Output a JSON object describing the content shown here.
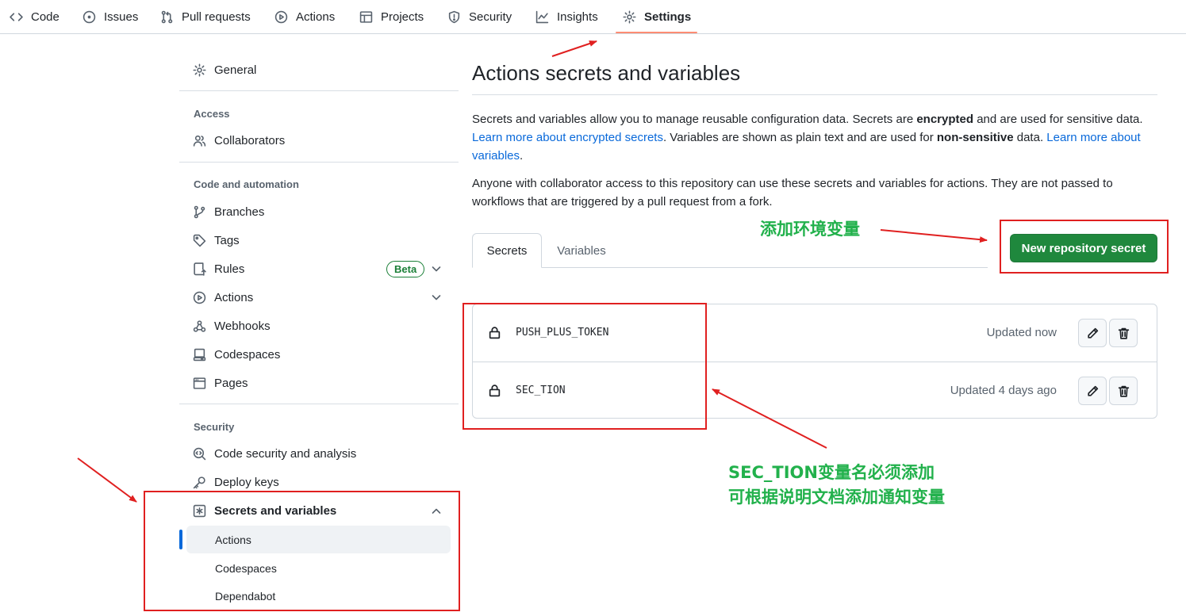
{
  "repo_nav": {
    "items": [
      {
        "label": "Code",
        "icon": "code-icon"
      },
      {
        "label": "Issues",
        "icon": "issue-opened-icon"
      },
      {
        "label": "Pull requests",
        "icon": "git-pull-request-icon"
      },
      {
        "label": "Actions",
        "icon": "play-icon"
      },
      {
        "label": "Projects",
        "icon": "table-icon"
      },
      {
        "label": "Security",
        "icon": "shield-icon"
      },
      {
        "label": "Insights",
        "icon": "graph-icon"
      },
      {
        "label": "Settings",
        "icon": "gear-icon",
        "selected": true
      }
    ]
  },
  "sidebar": {
    "general": "General",
    "access_heading": "Access",
    "collaborators": "Collaborators",
    "code_heading": "Code and automation",
    "branches": "Branches",
    "tags": "Tags",
    "rules": "Rules",
    "beta_badge": "Beta",
    "actions": "Actions",
    "webhooks": "Webhooks",
    "codespaces": "Codespaces",
    "pages": "Pages",
    "security_heading": "Security",
    "code_security": "Code security and analysis",
    "deploy_keys": "Deploy keys",
    "secrets_vars": "Secrets and variables",
    "sub_items": [
      "Actions",
      "Codespaces",
      "Dependabot"
    ]
  },
  "main": {
    "title": "Actions secrets and variables",
    "para1": {
      "t1": "Secrets and variables allow you to manage reusable configuration data. Secrets are ",
      "b1": "encrypted",
      "t2": " and are used for sensitive data. ",
      "link1": "Learn more about encrypted secrets",
      "t3": ". Variables are shown as plain text and are used for ",
      "b2": "non-sensitive",
      "t4": " data. ",
      "link2": "Learn more about variables",
      "t5": "."
    },
    "para2": "Anyone with collaborator access to this repository can use these secrets and variables for actions. They are not passed to workflows that are triggered by a pull request from a fork.",
    "tabs": [
      "Secrets",
      "Variables"
    ],
    "new_secret_button": "New repository secret",
    "secrets": [
      {
        "name": "PUSH_PLUS_TOKEN",
        "updated": "Updated now"
      },
      {
        "name": "SEC_TION",
        "updated": "Updated 4 days ago"
      }
    ]
  },
  "annotations": {
    "add_env": "添加环境变量",
    "sec_line1": "SEC_TION变量名必须添加",
    "sec_line2": "可根据说明文档添加通知变量"
  },
  "colors": {
    "accent_link": "#0969da",
    "primary_button": "#1f883d",
    "annotation_red": "#e02020",
    "annotation_green": "#22b14c",
    "tab_underline": "#fd8c73"
  }
}
